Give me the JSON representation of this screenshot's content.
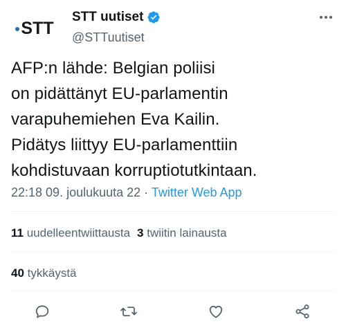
{
  "account": {
    "avatar_text": "STT",
    "name": "STT uutiset",
    "handle": "@STTuutiset"
  },
  "tweet": {
    "text": "AFP:n lähde: Belgian poliisi\non pidättänyt EU-parlamentin\nvarapuhemiehen Eva Kailin.\nPidätys liittyy EU-parlamenttiin\nkohdistuvaan korruptiotutkintaan.",
    "time": "22:18 09. joulukuuta 22",
    "separator": " · ",
    "app": "Twitter Web App"
  },
  "stats": {
    "retweets_count": "11",
    "retweets_label": "uudelleentwiittausta",
    "quotes_count": "3",
    "quotes_label": "twiitin lainausta",
    "likes_count": "40",
    "likes_label": "tykkäystä"
  },
  "icons": {
    "verified": "verified-badge-icon",
    "more": "more-dots-icon",
    "reply": "reply-icon",
    "retweet": "retweet-icon",
    "like": "heart-icon",
    "share": "share-icon"
  },
  "colors": {
    "text": "#0f1419",
    "secondary": "#536471",
    "link": "#1d9bf0",
    "verified": "#1d9bf0",
    "brand_dot": "#2a6cb3"
  }
}
